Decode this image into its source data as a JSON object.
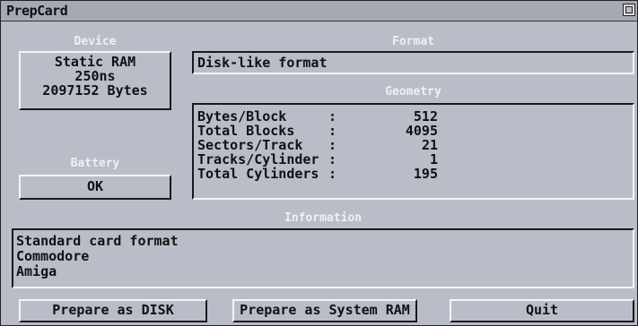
{
  "window": {
    "title": "PrepCard"
  },
  "device": {
    "heading": "Device",
    "lines": [
      "Static RAM",
      "250ns",
      "2097152 Bytes"
    ]
  },
  "battery": {
    "heading": "Battery",
    "status": "OK"
  },
  "format": {
    "heading": "Format",
    "value": "Disk-like format"
  },
  "geometry": {
    "heading": "Geometry",
    "rows": [
      {
        "label": "Bytes/Block",
        "colon": ":",
        "value": "512"
      },
      {
        "label": "Total Blocks",
        "colon": ":",
        "value": "4095"
      },
      {
        "label": "Sectors/Track",
        "colon": ":",
        "value": "21"
      },
      {
        "label": "Tracks/Cylinder",
        "colon": ":",
        "value": "1"
      },
      {
        "label": "Total Cylinders",
        "colon": ":",
        "value": "195"
      }
    ]
  },
  "information": {
    "heading": "Information",
    "lines": [
      "Standard card format",
      "Commodore",
      "Amiga"
    ]
  },
  "buttons": {
    "prepare_disk": "Prepare as DISK",
    "prepare_ram": "Prepare as System RAM",
    "quit": "Quit"
  }
}
